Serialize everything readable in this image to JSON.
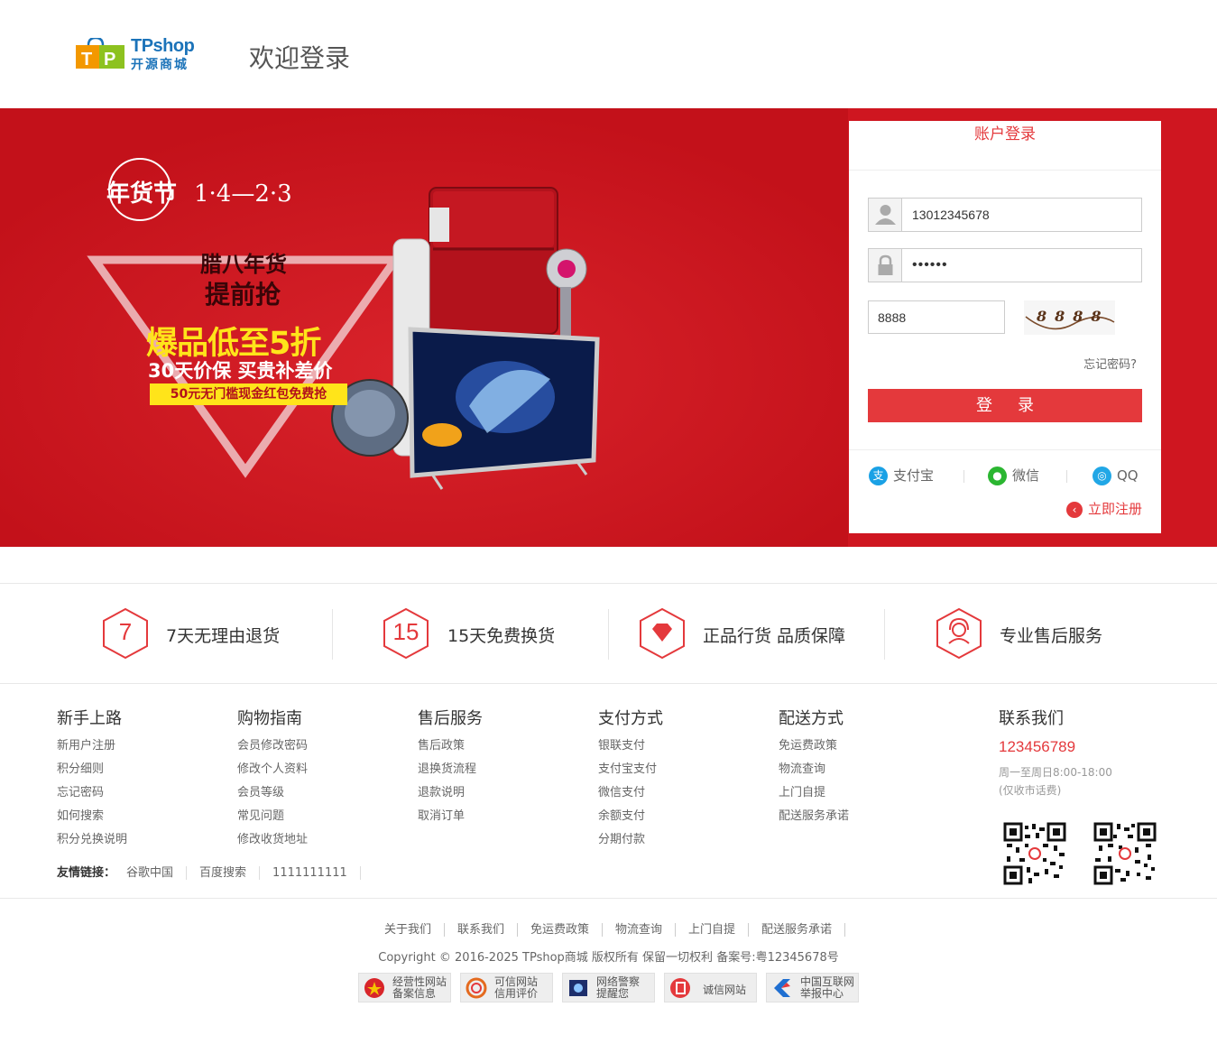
{
  "header": {
    "logo_text": "TPshop",
    "logo_subtext": "开源商城",
    "welcome": "欢迎登录"
  },
  "banner": {
    "event": "年货节",
    "dates": "1·4—2·3",
    "line1": "腊八年货",
    "line2": "提前抢",
    "headline": "爆品低至5折",
    "subline": "30天价保 买贵补差价",
    "tag": "50元无门槛现金红包免费抢"
  },
  "login": {
    "title": "账户登录",
    "username_value": "13012345678",
    "password_value": "••••••",
    "captcha_value": "8888",
    "captcha_text": "8888",
    "forget_label": "忘记密码?",
    "submit_label": "登录",
    "third_party": [
      {
        "label": "支付宝",
        "icon": "alipay-icon",
        "glyph": "支",
        "color": "#1aa1e5"
      },
      {
        "label": "微信",
        "icon": "wechat-icon",
        "glyph": "●",
        "color": "#2bb631"
      },
      {
        "label": "QQ",
        "icon": "qq-icon",
        "glyph": "◎",
        "color": "#21a7e6"
      }
    ],
    "register_label": "立即注册"
  },
  "services": [
    {
      "icon_text": "7",
      "label": "7天无理由退货"
    },
    {
      "icon_text": "15",
      "label": "15天免费换货"
    },
    {
      "icon_text": "",
      "label": "正品行货 品质保障"
    },
    {
      "icon_text": "",
      "label": "专业售后服务"
    }
  ],
  "footer": {
    "columns": [
      {
        "title": "新手上路",
        "links": [
          "新用户注册",
          "积分细则",
          "忘记密码",
          "如何搜索",
          "积分兑换说明"
        ]
      },
      {
        "title": "购物指南",
        "links": [
          "会员修改密码",
          "修改个人资料",
          "会员等级",
          "常见问题",
          "修改收货地址"
        ]
      },
      {
        "title": "售后服务",
        "links": [
          "售后政策",
          "退换货流程",
          "退款说明",
          "取消订单"
        ]
      },
      {
        "title": "支付方式",
        "links": [
          "银联支付",
          "支付宝支付",
          "微信支付",
          "余额支付",
          "分期付款"
        ]
      },
      {
        "title": "配送方式",
        "links": [
          "免运费政策",
          "物流查询",
          "上门自提",
          "配送服务承诺"
        ]
      }
    ],
    "contact": {
      "title": "联系我们",
      "phone": "123456789",
      "hours": "周一至周日8:00-18:00",
      "note": "(仅收市话费)"
    },
    "friends_label": "友情链接：",
    "friends": [
      "谷歌中国",
      "百度搜索",
      "1111111111"
    ]
  },
  "bottom": {
    "links": [
      "关于我们",
      "联系我们",
      "免运费政策",
      "物流查询",
      "上门自提",
      "配送服务承诺"
    ],
    "copyright": "Copyright © 2016-2025 TPshop商城 版权所有 保留一切权利 备案号:粤12345678号",
    "badges": [
      {
        "line1": "经营性网站",
        "line2": "备案信息",
        "icon": "police-badge-icon"
      },
      {
        "line1": "可信网站",
        "line2": "信用评价",
        "icon": "trust-icon"
      },
      {
        "line1": "网络警察",
        "line2": "提醒您",
        "icon": "cyber-police-icon"
      },
      {
        "line1": "诚信网站",
        "line2": "",
        "icon": "integrity-icon"
      },
      {
        "line1": "中国互联网",
        "line2": "举报中心",
        "icon": "report-center-icon"
      }
    ]
  }
}
